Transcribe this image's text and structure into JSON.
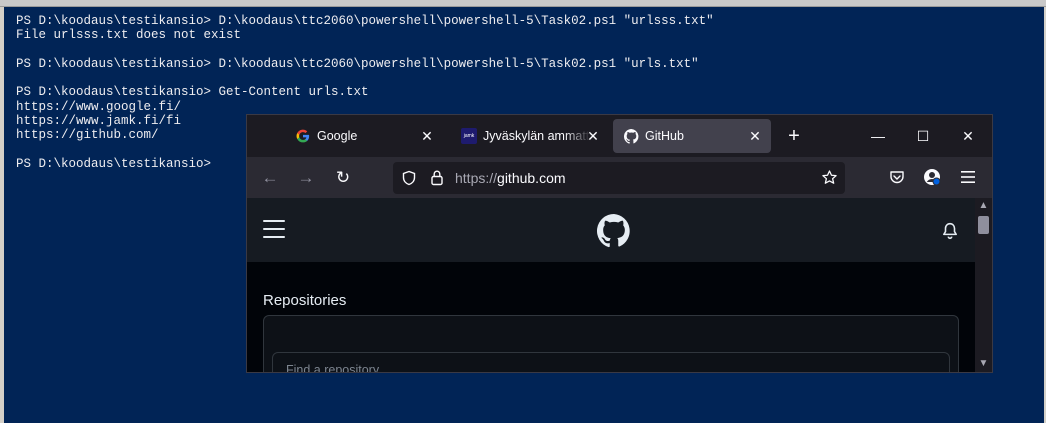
{
  "terminal": {
    "lines": [
      "PS D:\\koodaus\\testikansio> D:\\koodaus\\ttc2060\\powershell\\powershell-5\\Task02.ps1 \"urlsss.txt\"",
      "File urlsss.txt does not exist",
      "",
      "PS D:\\koodaus\\testikansio> D:\\koodaus\\ttc2060\\powershell\\powershell-5\\Task02.ps1 \"urls.txt\"",
      "",
      "PS D:\\koodaus\\testikansio> Get-Content urls.txt",
      "https://www.google.fi/",
      "https://www.jamk.fi/fi",
      "https://github.com/",
      "",
      "PS D:\\koodaus\\testikansio>"
    ],
    "background": "#012456"
  },
  "browser": {
    "tabs": [
      {
        "title": "Google",
        "icon": "google-favicon",
        "active": false
      },
      {
        "title": "Jyväskylän ammattikorkeakoulu",
        "icon": "jamk-favicon",
        "favicon_text": "jamk",
        "active": false
      },
      {
        "title": "GitHub",
        "icon": "github-favicon",
        "active": true
      }
    ],
    "new_tab_label": "+",
    "window_controls": {
      "minimize": "—",
      "maximize": "☐",
      "close": "✕"
    },
    "nav": {
      "back": "←",
      "forward": "→",
      "reload": "↻"
    },
    "url": {
      "scheme": "https://",
      "host": "github.com"
    },
    "page": {
      "repositories_label": "Repositories",
      "find_repo_placeholder": "Find a repository..."
    }
  }
}
